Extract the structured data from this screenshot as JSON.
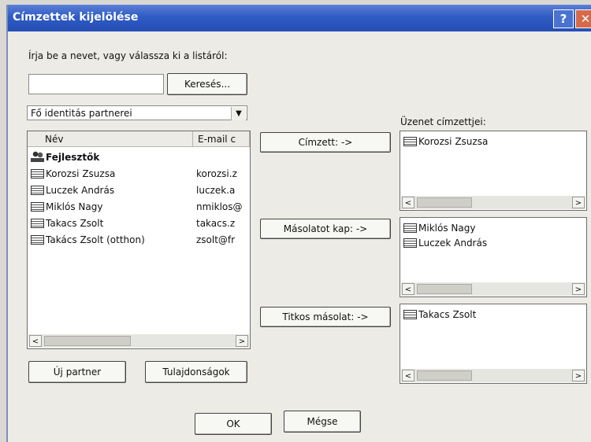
{
  "window": {
    "title": "Címzettek kijelölése",
    "help_glyph": "?",
    "close_glyph": "✕"
  },
  "search": {
    "prompt": "Írja be a nevet, vagy válassza ki a listáról:",
    "input_value": "",
    "button_label": "Keresés..."
  },
  "source": {
    "selected_option": "Fő identitás partnerei",
    "columns": [
      "Név",
      "E-mail c"
    ],
    "rows": [
      {
        "icon": "group-icon",
        "name": "Fejlesztők",
        "email": "",
        "bold": true
      },
      {
        "icon": "contact-card-icon",
        "name": "Korozsi Zsuzsa",
        "email": "korozsi.z"
      },
      {
        "icon": "contact-card-icon",
        "name": "Luczek András",
        "email": "luczek.a"
      },
      {
        "icon": "contact-card-icon",
        "name": "Miklós Nagy",
        "email": "nmiklos@"
      },
      {
        "icon": "contact-card-icon",
        "name": "Takacs Zsolt",
        "email": "takacs.z"
      },
      {
        "icon": "contact-card-icon",
        "name": "Takács Zsolt (otthon)",
        "email": "zsolt@fr"
      }
    ]
  },
  "buttons": {
    "to": "Címzett: ->",
    "cc": "Másolatot kap: ->",
    "bcc": "Titkos másolat: ->",
    "new_contact": "Új partner",
    "properties": "Tulajdonságok",
    "ok": "OK",
    "cancel": "Mégse"
  },
  "recipients": {
    "label": "Üzenet címzettjei:",
    "to": [
      "Korozsi Zsuzsa"
    ],
    "cc": [
      "Miklós Nagy",
      "Luczek András"
    ],
    "bcc": [
      "Takacs Zsolt"
    ]
  },
  "scroll_arrows": {
    "left": "<",
    "right": ">"
  }
}
